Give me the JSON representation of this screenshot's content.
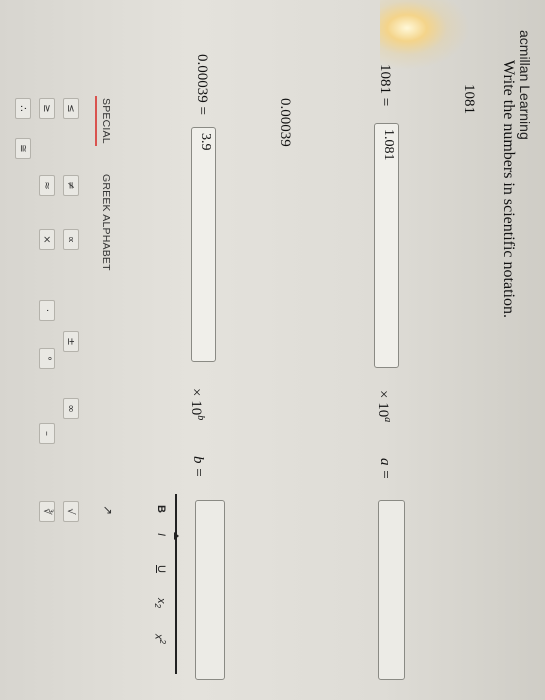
{
  "brand": "acmillan Learning",
  "instruction": "Write the numbers in scientific notation.",
  "q1": {
    "number": "1081",
    "equation_label": "1081 =",
    "coefficient_value": "1.081",
    "times_power": "× 10",
    "exponent": "a",
    "answer_label": "a =",
    "answer_value": ""
  },
  "q2": {
    "number": "0.00039",
    "equation_label": "0.00039 =",
    "coefficient_value": "3.9",
    "times_power": "× 10",
    "exponent": "b",
    "answer_label": "b =",
    "answer_value": ""
  },
  "toolbar": {
    "tab_special": "SPECIAL",
    "tab_greek": "GREEK ALPHABET",
    "collapse_glyph": "↗",
    "row1": [
      "≤",
      "≠",
      "∝",
      "±",
      "∞",
      "√"
    ],
    "row2": [
      "≥",
      "≈",
      "×",
      "·",
      "°",
      "–",
      "∛"
    ],
    "row3": [
      "∴",
      "≅"
    ],
    "format_bold": "B",
    "format_italic": "I",
    "format_underline": "U",
    "format_sub_base": "x",
    "format_sub_script": "2",
    "format_sup_base": "x",
    "format_sup_script": "2"
  },
  "colors": {
    "accent": "#d9534f",
    "dark_tab": "#222222"
  }
}
